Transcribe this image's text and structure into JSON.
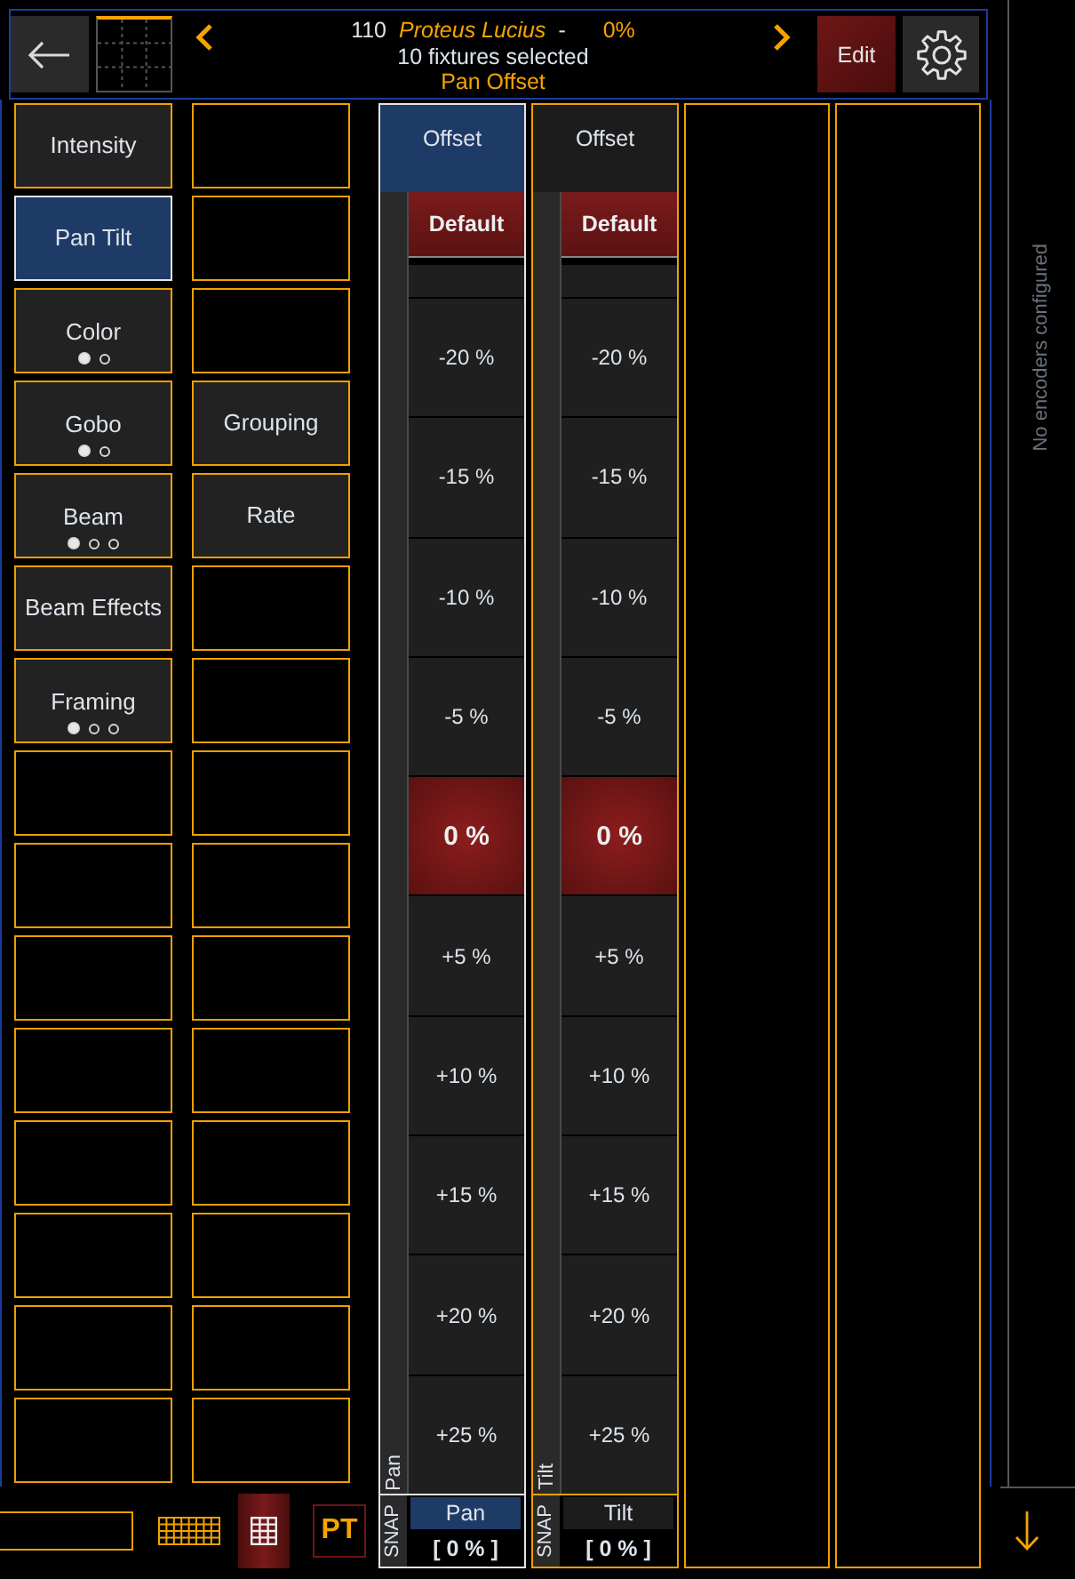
{
  "header": {
    "fixture_number": "110",
    "fixture_name": "Proteus Lucius",
    "separator": "-",
    "level_text": "0%",
    "selection": "10 fixtures selected",
    "parameter": "Pan Offset",
    "edit_label": "Edit"
  },
  "category_columns": [
    {
      "slots": [
        {
          "kind": "button",
          "label": "Intensity",
          "selected": false
        },
        {
          "kind": "button",
          "label": "Pan Tilt",
          "selected": true
        },
        {
          "kind": "button",
          "label": "Color",
          "selected": false,
          "pages": [
            {
              "selected": true
            },
            {
              "selected": false
            }
          ]
        },
        {
          "kind": "button",
          "label": "Gobo",
          "selected": false,
          "pages": [
            {
              "selected": true
            },
            {
              "selected": false
            }
          ]
        },
        {
          "kind": "button",
          "label": "Beam",
          "selected": false,
          "pages": [
            {
              "selected": true
            },
            {
              "selected": false
            },
            {
              "selected": false
            }
          ]
        },
        {
          "kind": "button",
          "label": "Beam Effects",
          "selected": false
        },
        {
          "kind": "button",
          "label": "Framing",
          "selected": false,
          "pages": [
            {
              "selected": true
            },
            {
              "selected": false
            },
            {
              "selected": false
            }
          ]
        },
        {
          "kind": "empty",
          "selected": false
        },
        {
          "kind": "empty",
          "selected": false
        },
        {
          "kind": "empty",
          "selected": false
        },
        {
          "kind": "empty",
          "selected": false
        },
        {
          "kind": "empty",
          "selected": false
        },
        {
          "kind": "empty",
          "selected": false
        },
        {
          "kind": "empty",
          "selected": false
        },
        {
          "kind": "empty",
          "selected": false
        }
      ]
    },
    {
      "slots": [
        {
          "kind": "empty",
          "selected": false
        },
        {
          "kind": "empty",
          "selected": false
        },
        {
          "kind": "empty",
          "selected": false
        },
        {
          "kind": "button",
          "label": "Grouping",
          "selected": false
        },
        {
          "kind": "button",
          "label": "Rate",
          "selected": false
        },
        {
          "kind": "empty",
          "selected": false
        },
        {
          "kind": "empty",
          "selected": false
        },
        {
          "kind": "empty",
          "selected": false
        },
        {
          "kind": "empty",
          "selected": false
        },
        {
          "kind": "empty",
          "selected": false
        },
        {
          "kind": "empty",
          "selected": false
        },
        {
          "kind": "empty",
          "selected": false
        },
        {
          "kind": "empty",
          "selected": false
        },
        {
          "kind": "empty",
          "selected": false
        },
        {
          "kind": "empty",
          "selected": false
        }
      ]
    }
  ],
  "fader_columns": [
    {
      "kind": "fader",
      "header": "Offset",
      "selected": true,
      "default_label": "Default",
      "steps": [
        {
          "kind": "blank",
          "selected": false
        },
        {
          "kind": "value",
          "label": "-20 %",
          "selected": false
        },
        {
          "kind": "value",
          "label": "-15 %",
          "selected": false
        },
        {
          "kind": "value",
          "label": "-10 %",
          "selected": false
        },
        {
          "kind": "value",
          "label": "-5 %",
          "selected": false
        },
        {
          "kind": "value",
          "label": "0 %",
          "selected": true
        },
        {
          "kind": "value",
          "label": "+5 %",
          "selected": false
        },
        {
          "kind": "value",
          "label": "+10 %",
          "selected": false
        },
        {
          "kind": "value",
          "label": "+15 %",
          "selected": false
        },
        {
          "kind": "value",
          "label": "+20 %",
          "selected": false
        },
        {
          "kind": "value",
          "label": "+25 %",
          "selected": false
        }
      ],
      "axis_label": "Pan",
      "snap_label": "SNAP",
      "name": "Pan",
      "value": "[ 0 % ]"
    },
    {
      "kind": "fader",
      "header": "Offset",
      "selected": false,
      "default_label": "Default",
      "steps": [
        {
          "kind": "blank",
          "selected": false
        },
        {
          "kind": "value",
          "label": "-20 %",
          "selected": false
        },
        {
          "kind": "value",
          "label": "-15 %",
          "selected": false
        },
        {
          "kind": "value",
          "label": "-10 %",
          "selected": false
        },
        {
          "kind": "value",
          "label": "-5 %",
          "selected": false
        },
        {
          "kind": "value",
          "label": "0 %",
          "selected": true
        },
        {
          "kind": "value",
          "label": "+5 %",
          "selected": false
        },
        {
          "kind": "value",
          "label": "+10 %",
          "selected": false
        },
        {
          "kind": "value",
          "label": "+15 %",
          "selected": false
        },
        {
          "kind": "value",
          "label": "+20 %",
          "selected": false
        },
        {
          "kind": "value",
          "label": "+25 %",
          "selected": false
        }
      ],
      "axis_label": "Tilt",
      "snap_label": "SNAP",
      "name": "Tilt",
      "value": "[ 0 % ]"
    },
    {
      "kind": "empty",
      "selected": false
    },
    {
      "kind": "empty",
      "selected": false
    }
  ],
  "toolbar": {
    "grid_on": true,
    "pt_label": "PT"
  },
  "encoders_panel": {
    "message": "No encoders configured"
  }
}
